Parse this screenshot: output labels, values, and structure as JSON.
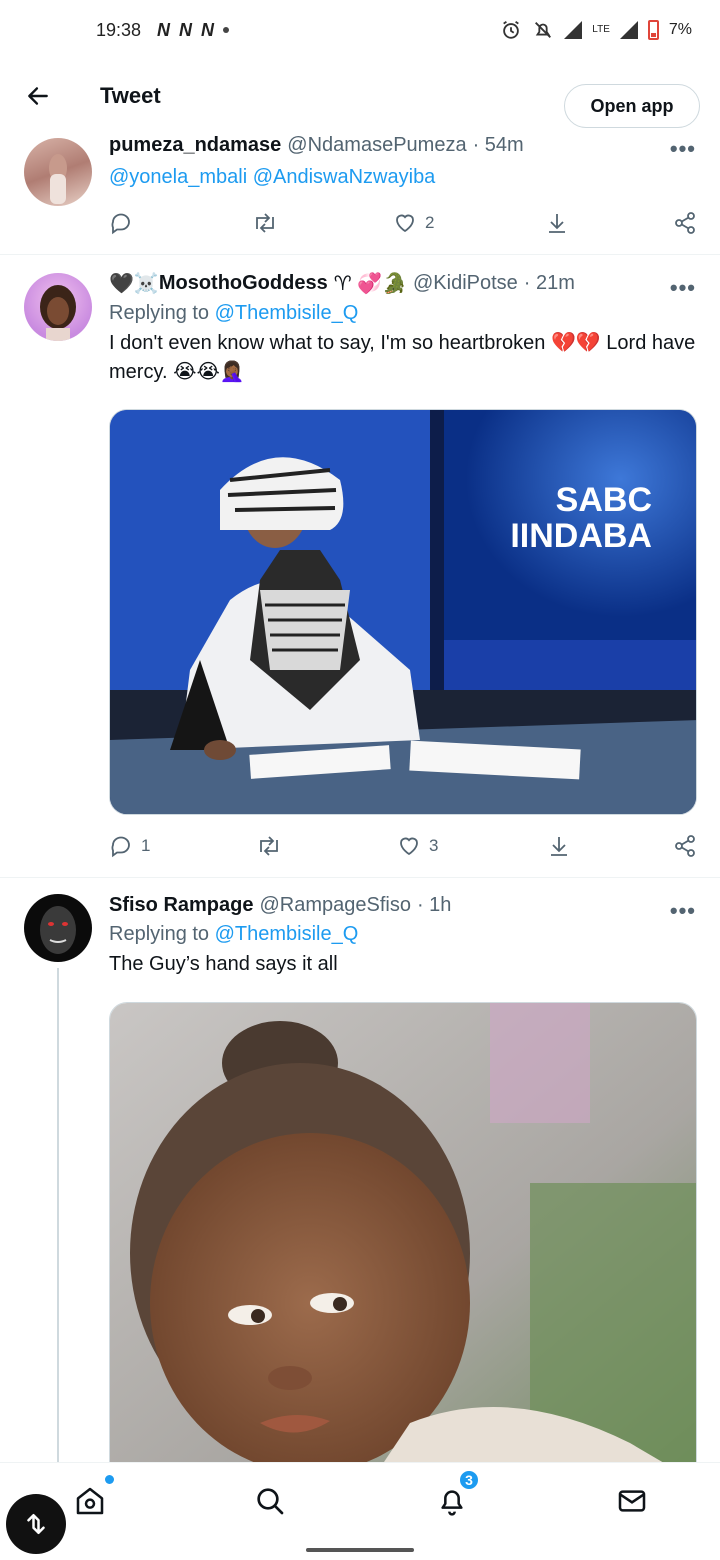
{
  "status_bar": {
    "time": "19:38",
    "app_icons": [
      "N",
      "N",
      "N"
    ],
    "network": "LTE",
    "battery": "7%"
  },
  "header": {
    "title": "Tweet",
    "open_app_label": "Open app"
  },
  "tweets": [
    {
      "name": "pumeza_ndamase",
      "handle": "@NdamasePumeza",
      "time": "· 54m",
      "mentions": "@yonela_mbali @AndiswaNzwayiba",
      "likes": "2",
      "replies": ""
    },
    {
      "name": "MosothoGoddess",
      "name_prefix_emoji": "🖤☠️",
      "name_suffix_emoji": "♈ 💞🐊",
      "handle": "@KidiPotse",
      "time": "· 21m",
      "replying_label": "Replying to",
      "replying_to": "@Thembisile_Q",
      "text": "I don't even know what to say, I'm so heartbroken 💔💔 Lord have mercy. 😭😭🤦🏾‍♀️",
      "media": {
        "logo_line1": "SABC",
        "logo_line2": "IINDABA"
      },
      "replies": "1",
      "likes": "3"
    },
    {
      "name": "Sfiso Rampage",
      "handle": "@RampageSfiso",
      "time": "· 1h",
      "replying_label": "Replying to",
      "replying_to": "@Thembisile_Q",
      "text": "The Guy’s hand says it all"
    }
  ],
  "bottom_nav": {
    "notifications_badge": "3"
  },
  "colors": {
    "accent": "#1d9bf0",
    "text_primary": "#0f1419",
    "text_secondary": "#536471"
  }
}
